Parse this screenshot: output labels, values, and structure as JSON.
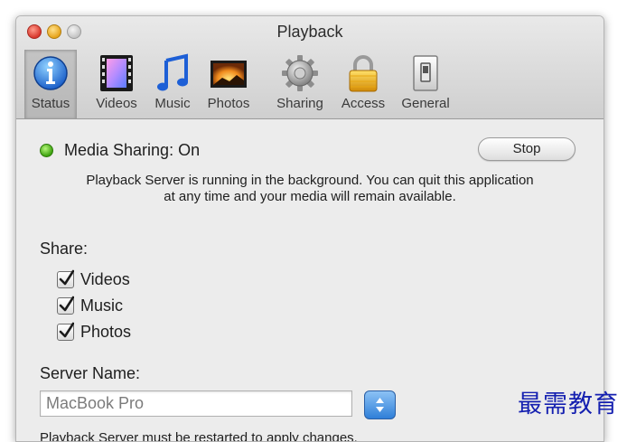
{
  "window": {
    "title": "Playback"
  },
  "toolbar": {
    "items": [
      {
        "label": "Status",
        "icon": "info-icon",
        "selected": true
      },
      {
        "label": "Videos",
        "icon": "film-strip-icon"
      },
      {
        "label": "Music",
        "icon": "music-note-icon"
      },
      {
        "label": "Photos",
        "icon": "photo-icon"
      },
      {
        "label": "Sharing",
        "icon": "gear-icon"
      },
      {
        "label": "Access",
        "icon": "padlock-icon"
      },
      {
        "label": "General",
        "icon": "switch-icon"
      }
    ]
  },
  "status": {
    "text": "Media Sharing: On",
    "indicator_color": "#3ca10e",
    "stop_label": "Stop",
    "description_line1": "Playback Server is running in the background. You can quit this application",
    "description_line2": "at any time and your media will remain available."
  },
  "share": {
    "label": "Share:",
    "options": [
      {
        "label": "Videos",
        "checked": true
      },
      {
        "label": "Music",
        "checked": true
      },
      {
        "label": "Photos",
        "checked": true
      }
    ]
  },
  "server": {
    "label": "Server Name:",
    "value": "MacBook Pro",
    "note": "Playback Server must be restarted to apply changes."
  },
  "watermark": {
    "text": "最需教育"
  }
}
